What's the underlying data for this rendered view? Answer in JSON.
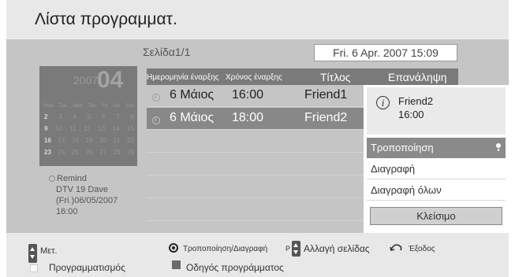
{
  "header": {
    "title": "Λίστα προγραμματ."
  },
  "page_counter": "Σελίδα1/1",
  "datetime": "Fri. 6 Apr. 2007 15:09",
  "calendar": {
    "year": "2007",
    "month": "04",
    "weekdays": [
      "Mon",
      "Tue",
      "Wed",
      "Thu",
      "Fri",
      "Sat",
      "Sun"
    ],
    "weeks": [
      [
        "2",
        "3",
        "4",
        "5",
        "6",
        "7",
        "8"
      ],
      [
        "9",
        "10",
        "11",
        "12",
        "13",
        "14",
        "15"
      ],
      [
        "16",
        "17",
        "18",
        "19",
        "20",
        "21",
        "22"
      ],
      [
        "23",
        "24",
        "25",
        "26",
        "27",
        "28",
        "29"
      ]
    ]
  },
  "remind": {
    "label": "Remind",
    "channel": "DTV 19 Dave",
    "date": "(Fri.)06/05/2007",
    "time": "16:00"
  },
  "list": {
    "headers": {
      "start_date": "Ημερομηνία έναρξης",
      "start_time": "Χρόνος έναρξης",
      "title": "Τίτλος",
      "repeat": "Επανάληψη"
    },
    "rows": [
      {
        "date": "6 Μάιος",
        "time": "16:00",
        "title": "Friend1"
      },
      {
        "date": "6 Μάιος",
        "time": "18:00",
        "title": "Friend2"
      }
    ]
  },
  "popup": {
    "program": "Friend2",
    "time": "16:00",
    "info_glyph": "i",
    "menu": {
      "modify": "Τροποποίηση",
      "delete": "Διαγραφή",
      "delete_all": "Διαγραφή όλων"
    },
    "close": "Κλείσιμο"
  },
  "footer": {
    "move": "Μετ.",
    "program": "Προγραμματισμός",
    "modify_delete": "Τροποποίηση/Διαγραφή",
    "p_letter": "P",
    "page_change": "Αλλαγή σελίδας",
    "exit": "Έξοδος",
    "guide": "Οδηγός προγράμματος"
  },
  "colors": {
    "panel": "#c5c5c5",
    "header_bar": "#7a7a7a",
    "selected_row": "#888888",
    "highlighted_menu": "#8a8a8a"
  }
}
